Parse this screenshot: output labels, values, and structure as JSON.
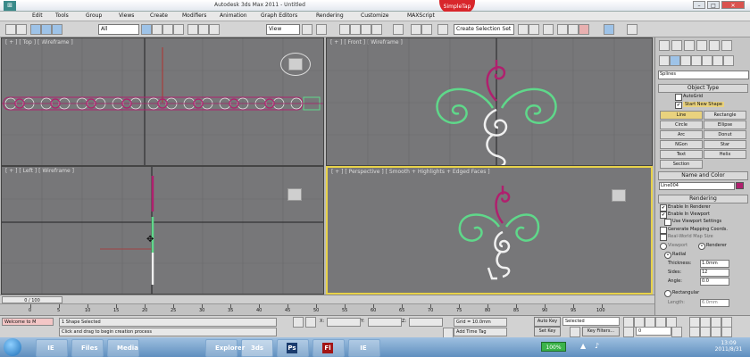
{
  "window": {
    "title": "Autodesk 3ds Max 2011 - Untitled",
    "badge": "SimpleTap"
  },
  "menu": [
    "Edit",
    "Tools",
    "Group",
    "Views",
    "Create",
    "Modifiers",
    "Animation",
    "Graph Editors",
    "Rendering",
    "Customize",
    "MAXScript"
  ],
  "toolbar": {
    "selection_filter": "All",
    "ref_coord": "View",
    "named_selection": "Create Selection Set"
  },
  "viewports": {
    "top": "[ + ] [ Top ] [ Wireframe ]",
    "front": "[ + ] [ Front ] [ Wireframe ]",
    "left": "[ + ] [ Left ] [ Wireframe ]",
    "perspective": "[ + ] [ Perspective ] [ Smooth + Highlights + Edged Faces ]",
    "cube_labels": {
      "top": "TOP",
      "front": "FRONT",
      "left": "LEFT",
      "persp": "FRONT"
    }
  },
  "command_panel": {
    "category": "Splines",
    "object_type_title": "Object Type",
    "autogrid": "AutoGrid",
    "start_new_shape": "Start New Shape",
    "buttons": [
      "Line",
      "Rectangle",
      "Circle",
      "Ellipse",
      "Arc",
      "Donut",
      "NGon",
      "Star",
      "Text",
      "Helix",
      "Section"
    ],
    "active_button": "Line",
    "name_color_title": "Name and Color",
    "object_name": "Line004",
    "rendering_title": "Rendering",
    "enable_renderer": "Enable In Renderer",
    "enable_viewport": "Enable In Viewport",
    "use_viewport_settings": "Use Viewport Settings",
    "gen_mapping": "Generate Mapping Coords.",
    "real_world": "Real-World Map Size",
    "viewport_radio": "Viewport",
    "renderer_radio": "Renderer",
    "radial": "Radial",
    "thickness_label": "Thickness:",
    "thickness": "1.0mm",
    "sides_label": "Sides:",
    "sides": "12",
    "angle_label": "Angle:",
    "angle": "0.0",
    "rectangular": "Rectangular",
    "length_label": "Length:",
    "length": "6.0mm"
  },
  "timeline": {
    "frame": "0 / 100",
    "ticks": [
      "0",
      "5",
      "10",
      "15",
      "20",
      "25",
      "30",
      "35",
      "40",
      "45",
      "50",
      "55",
      "60",
      "65",
      "70",
      "75",
      "80",
      "85",
      "90",
      "95",
      "100"
    ]
  },
  "status": {
    "listener": "Welcome to M",
    "selection": "1 Shape Selected",
    "prompt": "Click and drag to begin creation process",
    "x_label": "X:",
    "y_label": "Y:",
    "z_label": "Z:",
    "grid": "Grid = 10.0mm",
    "add_time_tag": "Add Time Tag",
    "auto_key": "Auto Key",
    "selected": "Selected",
    "set_key": "Set Key",
    "key_filters": "Key Filters...",
    "frame_field": "0"
  },
  "taskbar": {
    "apps": [
      "IE",
      "Files",
      "Media",
      "Explorer",
      "3ds",
      "Ps",
      "Fl",
      "IE"
    ],
    "battery": "100%",
    "time": "13:09",
    "date": "2011/8/31"
  },
  "colors": {
    "magenta": "#b0206e",
    "green": "#5fd88a",
    "white": "#f0f0f0",
    "viewport": "#777779",
    "active_border": "#e8d24a"
  }
}
